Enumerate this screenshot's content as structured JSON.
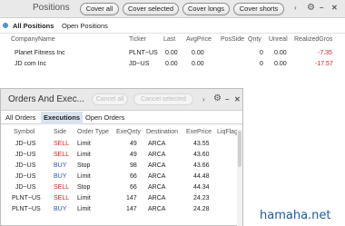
{
  "positions": {
    "title": "Positions",
    "buttons": [
      "Cover all",
      "Cover selected",
      "Cover longs",
      "Cover shorts"
    ],
    "tabs": [
      "All Positions",
      "Open Positions"
    ],
    "columns": [
      "CompanyName",
      "Ticker",
      "Last",
      "AvgPrice",
      "PosSide",
      "Qnty",
      "Unreal",
      "RealizedGros"
    ],
    "rows": [
      {
        "company": "Planet Fitness Inc",
        "ticker": "PLNT~US",
        "last": "0.00",
        "avg": "0.00",
        "side": "",
        "qnty": "0",
        "unreal": "0.00",
        "realized": "-7.35"
      },
      {
        "company": "JD com Inc",
        "ticker": "JD~US",
        "last": "0.00",
        "avg": "0.00",
        "side": "",
        "qnty": "0",
        "unreal": "0.00",
        "realized": "-17.57"
      }
    ],
    "icons": [
      "chevron-right-icon",
      "gear-icon",
      "minimize-icon",
      "close-icon"
    ]
  },
  "orders": {
    "title": "Orders And Exec...",
    "buttons": [
      "Cancel all",
      "Cancel selected"
    ],
    "tabs": [
      "All Orders",
      "Executions",
      "Open Orders"
    ],
    "active_tab": "Executions",
    "columns": [
      "Symbol",
      "Side",
      "Order Type",
      "ExeQnty",
      "Destination",
      "ExePrice",
      "LiqFlag"
    ],
    "rows": [
      {
        "symbol": "JD~US",
        "side": "SELL",
        "type": "Limit",
        "qnty": "49",
        "dest": "ARCA",
        "price": "43.55",
        "liq": ""
      },
      {
        "symbol": "JD~US",
        "side": "SELL",
        "type": "Limit",
        "qnty": "49",
        "dest": "ARCA",
        "price": "43.60",
        "liq": ""
      },
      {
        "symbol": "JD~US",
        "side": "BUY",
        "type": "Stop",
        "qnty": "98",
        "dest": "ARCA",
        "price": "43.66",
        "liq": ""
      },
      {
        "symbol": "JD~US",
        "side": "BUY",
        "type": "Limit",
        "qnty": "66",
        "dest": "ARCA",
        "price": "44.48",
        "liq": ""
      },
      {
        "symbol": "JD~US",
        "side": "SELL",
        "type": "Stop",
        "qnty": "66",
        "dest": "ARCA",
        "price": "44.34",
        "liq": ""
      },
      {
        "symbol": "PLNT~US",
        "side": "SELL",
        "type": "Limit",
        "qnty": "147",
        "dest": "ARCA",
        "price": "24.23",
        "liq": ""
      },
      {
        "symbol": "PLNT~US",
        "side": "BUY",
        "type": "Limit",
        "qnty": "147",
        "dest": "ARCA",
        "price": "24.28",
        "liq": ""
      }
    ],
    "icons": [
      "chevron-right-icon",
      "gear-icon",
      "minimize-icon",
      "close-icon"
    ]
  },
  "watermark": "hamaha.net",
  "colors": {
    "sell": "#d42020",
    "buy": "#2b55b8",
    "negative": "#d42020",
    "active_tab_bg": "#d9e3ef"
  }
}
